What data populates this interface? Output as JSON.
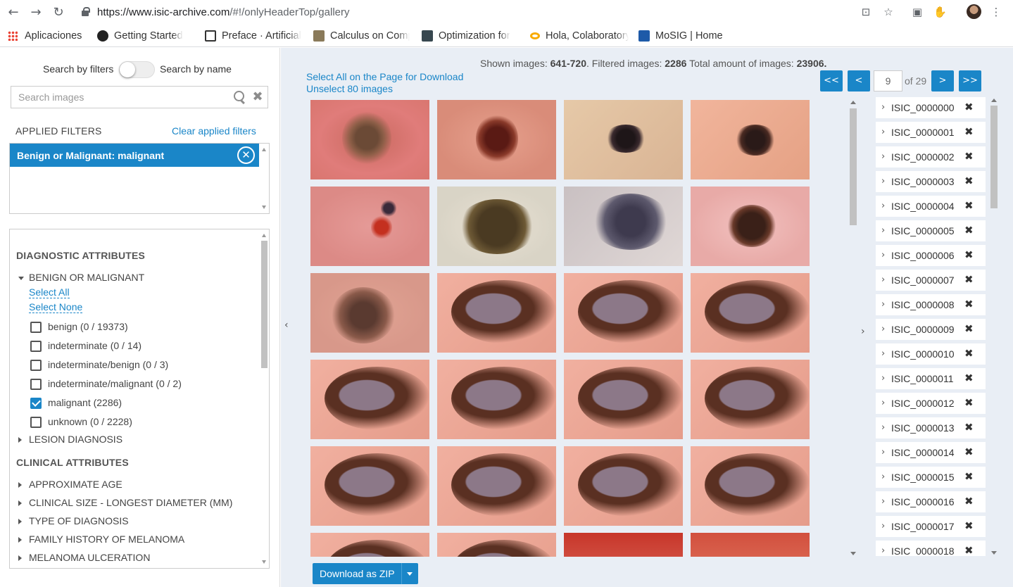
{
  "browser": {
    "url_host": "https://www.isic-archive.com",
    "url_path": "/#!/onlyHeaderTop/gallery",
    "bookmarks": [
      {
        "label": "Aplicaciones",
        "icon": "apps-grid-icon",
        "color": "#ea4335"
      },
      {
        "label": "Getting Started",
        "icon": "react-logo-icon",
        "color": "#222222"
      },
      {
        "label": "Preface · Artificial",
        "icon": "book-icon",
        "color": "#333333"
      },
      {
        "label": "Calculus on Computational Graphs",
        "icon": "image-thumb-icon",
        "color": "#8a7a5a"
      },
      {
        "label": "Optimization for",
        "icon": "document-icon",
        "color": "#37474f"
      },
      {
        "label": "Hola, Colaboratory",
        "icon": "colab-icon",
        "color": "#f9ab00"
      },
      {
        "label": "MoSIG | Home",
        "icon": "mosig-logo-icon",
        "color": "#1e5aa8"
      }
    ]
  },
  "filters": {
    "search_by_filters_label": "Search by filters",
    "search_by_name_label": "Search by name",
    "search_placeholder": "Search images",
    "applied_header": "APPLIED FILTERS",
    "clear_applied_label": "Clear applied filters",
    "applied": [
      "Benign or Malignant: malignant"
    ],
    "diagnostic_title": "DIAGNOSTIC ATTRIBUTES",
    "benign_or_malignant_title": "BENIGN OR MALIGNANT",
    "select_all_label": "Select All",
    "select_none_label": "Select None",
    "options": [
      {
        "label": "benign (0 / 19373)",
        "checked": false
      },
      {
        "label": "indeterminate (0 / 14)",
        "checked": false
      },
      {
        "label": "indeterminate/benign (0 / 3)",
        "checked": false
      },
      {
        "label": "indeterminate/malignant (0 / 2)",
        "checked": false
      },
      {
        "label": "malignant (2286)",
        "checked": true
      },
      {
        "label": "unknown (0 / 2228)",
        "checked": false
      }
    ],
    "lesion_diagnosis_title": "LESION DIAGNOSIS",
    "clinical_title": "CLINICAL ATTRIBUTES",
    "clinical_facets": [
      "APPROXIMATE AGE",
      "CLINICAL SIZE - LONGEST DIAMETER (MM)",
      "TYPE OF DIAGNOSIS",
      "FAMILY HISTORY OF MELANOMA",
      "MELANOMA ULCERATION"
    ]
  },
  "gallery": {
    "stats_shown_label": "Shown images:",
    "stats_shown_value": "641-720",
    "stats_filtered_label": "Filtered images:",
    "stats_filtered_value": "2286",
    "stats_total_label": "Total amount of images:",
    "stats_total_value": "23906.",
    "select_all_page_label": "Select All on the Page for Download",
    "unselect_label": "Unselect 80 images",
    "pagination": {
      "first_label": "<<",
      "prev_label": "<",
      "next_label": ">",
      "last_label": ">>",
      "current_page": "9",
      "of_label": "of 29"
    },
    "download_label": "Download as ZIP",
    "collapse_left_glyph": "‹",
    "collapse_right_glyph": "›"
  },
  "image_list": [
    "ISIC_0000000",
    "ISIC_0000001",
    "ISIC_0000002",
    "ISIC_0000003",
    "ISIC_0000004",
    "ISIC_0000005",
    "ISIC_0000006",
    "ISIC_0000007",
    "ISIC_0000008",
    "ISIC_0000009",
    "ISIC_0000010",
    "ISIC_0000011",
    "ISIC_0000012",
    "ISIC_0000013",
    "ISIC_0000014",
    "ISIC_0000015",
    "ISIC_0000016",
    "ISIC_0000017",
    "ISIC_0000018"
  ],
  "colors": {
    "accent": "#1a86c8",
    "main_bg": "#e9eef5"
  }
}
